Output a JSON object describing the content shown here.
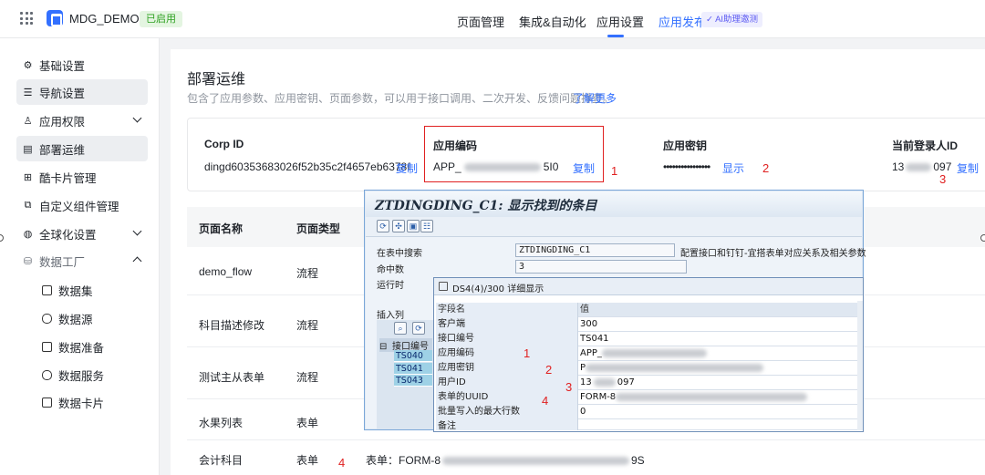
{
  "topbar": {
    "app_name": "MDG_DEMO",
    "status": "已启用",
    "nav": [
      "页面管理",
      "集成&自动化",
      "应用设置"
    ],
    "publish": "应用发布",
    "ai_badge": "✓ AI助理邀测"
  },
  "sidebar": {
    "items": [
      {
        "label": "基础设置",
        "icon": "gear-icon"
      },
      {
        "label": "导航设置",
        "icon": "list-icon"
      },
      {
        "label": "应用权限",
        "icon": "user-icon"
      },
      {
        "label": "部署运维",
        "icon": "doc-icon"
      },
      {
        "label": "酷卡片管理",
        "icon": "grid-icon"
      },
      {
        "label": "自定义组件管理",
        "icon": "component-icon"
      },
      {
        "label": "全球化设置",
        "icon": "globe-icon"
      },
      {
        "label": "数据工厂",
        "icon": "database-icon"
      }
    ],
    "sub_items": [
      "数据集",
      "数据源",
      "数据准备",
      "数据服务",
      "数据卡片"
    ]
  },
  "content": {
    "title": "部署运维",
    "desc": "包含了应用参数、应用密钥、页面参数，可以用于接口调用、二次开发、反馈问题排查。",
    "more": "了解更多",
    "info": {
      "corp_label": "Corp ID",
      "corp_value": "dingd60353683026f52b35c2f4657eb6378f",
      "copy": "复制",
      "code_label": "应用编码",
      "code_prefix": "APP_",
      "code_suffix": "5I0",
      "secret_label": "应用密钥",
      "secret_value": "••••••••••••••••",
      "show": "显示",
      "user_label": "当前登录人ID",
      "user_prefix": "13",
      "user_suffix": "097"
    },
    "table": {
      "headers": [
        "页面名称",
        "页面类型"
      ],
      "rows": [
        {
          "name": "demo_flow",
          "type": "流程"
        },
        {
          "name": "科目描述修改",
          "type": "流程"
        },
        {
          "name": "测试主从表单",
          "type": "流程"
        },
        {
          "name": "水果列表",
          "type": "表单"
        },
        {
          "name": "会计科目",
          "type": "表单"
        }
      ],
      "last_row_extra_prefix": "表单：FORM-8",
      "last_row_extra_suffix": "9S"
    },
    "annotations": [
      "1",
      "2",
      "3",
      "4"
    ]
  },
  "sap": {
    "title": "ZTDINGDING_C1: 显示找到的条目",
    "search_label": "在表中搜索",
    "search_value": "ZTDINGDING_C1",
    "search_note": "配置接口和钉钉-宜搭表单对应关系及相关参数",
    "hits_label": "命中数",
    "hits_value": "3",
    "runtime_label": "运行时",
    "insert_label": "插入列",
    "grid_header": "接口编号",
    "grid_rows": [
      "TS040",
      "TS041",
      "TS043"
    ],
    "dialog": {
      "title": "DS4(4)/300 详细显示",
      "col_field": "字段名",
      "col_value": "值",
      "rows": [
        {
          "k": "客户端",
          "v": "300"
        },
        {
          "k": "接口编号",
          "v": "TS041"
        },
        {
          "k": "应用编码",
          "v": "APP_"
        },
        {
          "k": "应用密钥",
          "v": "P"
        },
        {
          "k": "用户ID",
          "v": "13",
          "v2": "097"
        },
        {
          "k": "表单的UUID",
          "v": "FORM-8"
        },
        {
          "k": "批量写入的最大行数",
          "v": "0"
        },
        {
          "k": "备注",
          "v": ""
        }
      ]
    }
  },
  "colors": {
    "accent": "#3370ff",
    "annotation": "#e02020",
    "status": "#2ea121"
  }
}
